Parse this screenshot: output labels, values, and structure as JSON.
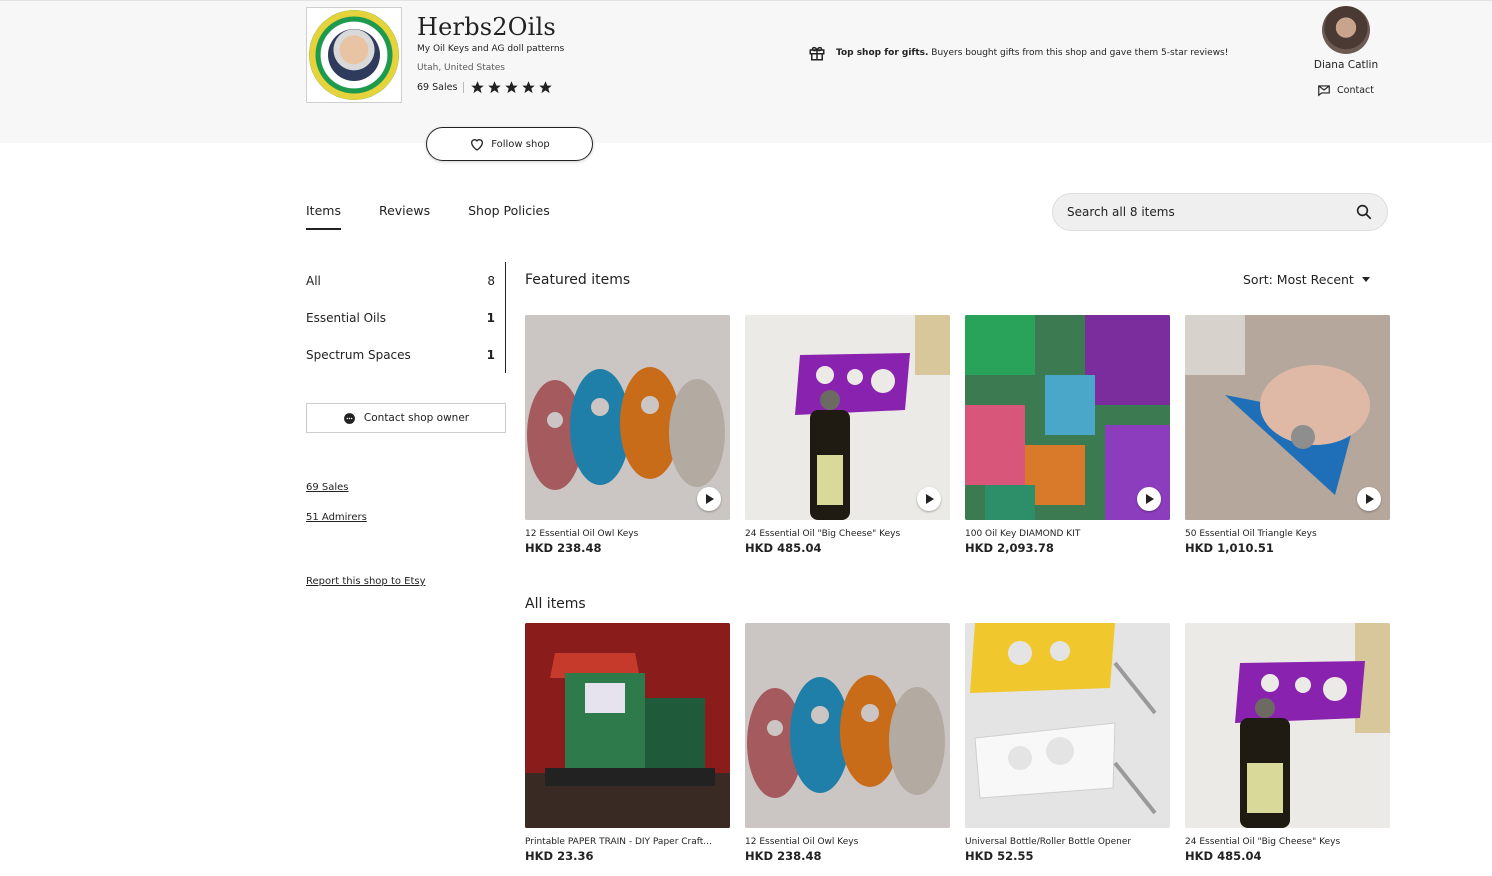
{
  "shop": {
    "name": "Herbs2Oils",
    "tagline": "My Oil Keys and AG doll patterns",
    "location": "Utah, United States",
    "sales_label": "69 Sales",
    "rating_stars": 5,
    "follow_label": "Follow shop",
    "top_shop_bold": "Top shop for gifts.",
    "top_shop_text": "Buyers bought gifts from this shop and gave them 5-star reviews!"
  },
  "owner": {
    "name": "Diana Catlin",
    "contact_label": "Contact"
  },
  "tabs": [
    {
      "label": "Items",
      "active": true
    },
    {
      "label": "Reviews",
      "active": false
    },
    {
      "label": "Shop Policies",
      "active": false
    }
  ],
  "search": {
    "placeholder": "Search all 8 items"
  },
  "categories": [
    {
      "label": "All",
      "count": "8"
    },
    {
      "label": "Essential Oils",
      "count": "1"
    },
    {
      "label": "Spectrum Spaces",
      "count": "1"
    }
  ],
  "sidebar": {
    "contact_owner_label": "Contact shop owner",
    "sales_link": "69 Sales",
    "admirers_link": "51 Admirers",
    "report_link": "Report this shop to Etsy"
  },
  "featured": {
    "title": "Featured items",
    "sort_label": "Sort: Most Recent",
    "items": [
      {
        "title": "12 Essential Oil Owl Keys",
        "price": "HKD 238.48",
        "art": "owl",
        "video": true
      },
      {
        "title": "24 Essential Oil \"Big Cheese\" Keys",
        "price": "HKD 485.04",
        "art": "cheese",
        "video": true
      },
      {
        "title": "100 Oil Key DIAMOND KIT",
        "price": "HKD 2,093.78",
        "art": "diamond",
        "video": true
      },
      {
        "title": "50 Essential Oil Triangle Keys",
        "price": "HKD 1,010.51",
        "art": "triangle",
        "video": true
      }
    ]
  },
  "all_items": {
    "title": "All items",
    "items": [
      {
        "title": "Printable PAPER TRAIN - DIY Paper Craft...",
        "price": "HKD 23.36",
        "art": "train"
      },
      {
        "title": "12 Essential Oil Owl Keys",
        "price": "HKD 238.48",
        "art": "owl"
      },
      {
        "title": "Universal Bottle/Roller Bottle Opener",
        "price": "HKD 52.55",
        "art": "opener"
      },
      {
        "title": "24 Essential Oil \"Big Cheese\" Keys",
        "price": "HKD 485.04",
        "art": "cheese"
      }
    ]
  }
}
